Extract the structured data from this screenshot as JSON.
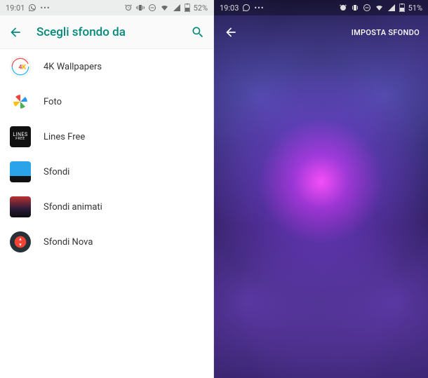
{
  "left": {
    "status": {
      "time": "19:01",
      "battery_text": "52%"
    },
    "appbar": {
      "title": "Scegli sfondo da"
    },
    "items": [
      {
        "label": "4K Wallpapers"
      },
      {
        "label": "Foto"
      },
      {
        "label": "Lines Free"
      },
      {
        "label": "Sfondi"
      },
      {
        "label": "Sfondi animati"
      },
      {
        "label": "Sfondi Nova"
      }
    ]
  },
  "right": {
    "status": {
      "time": "19:03",
      "battery_text": "51%"
    },
    "action_label": "IMPOSTA SFONDO"
  },
  "colors": {
    "accent": "#00897b"
  }
}
